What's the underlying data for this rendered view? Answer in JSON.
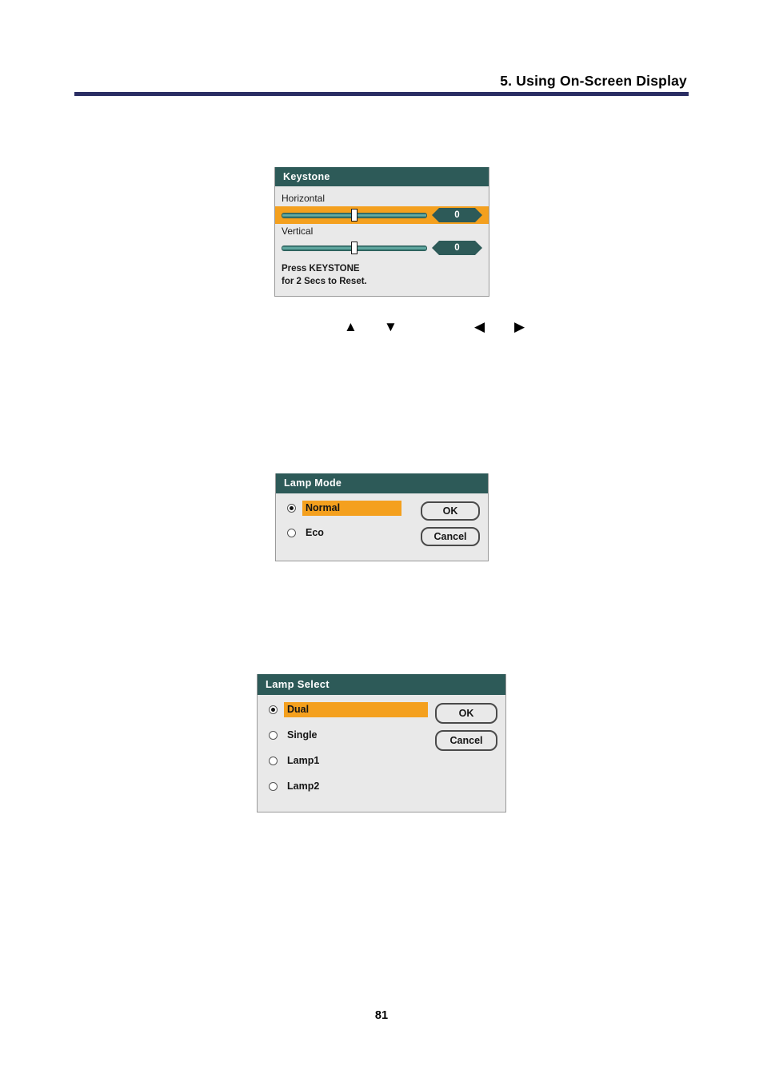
{
  "page": {
    "header_title": "5. Using On-Screen Display",
    "page_number": "81",
    "accent_navy": "#2a2d63",
    "osd_title_teal": "#2d5a58",
    "osd_body_gray": "#e9e9e9",
    "highlight_orange": "#f4a01e"
  },
  "keystone": {
    "title": "Keystone",
    "horizontal": {
      "label": "Horizontal",
      "value": "0",
      "slider_position_percent": 50
    },
    "vertical": {
      "label": "Vertical",
      "value": "0",
      "slider_position_percent": 50
    },
    "note_line1": "Press KEYSTONE",
    "note_line2": "for 2 Secs to Reset."
  },
  "arrows": {
    "up": "▲",
    "down": "▼",
    "left": "◀",
    "right": "▶"
  },
  "lamp_mode": {
    "title": "Lamp Mode",
    "options": [
      {
        "label": "Normal",
        "selected": true
      },
      {
        "label": "Eco",
        "selected": false
      }
    ],
    "buttons": [
      {
        "label": "OK"
      },
      {
        "label": "Cancel"
      }
    ]
  },
  "lamp_select": {
    "title": "Lamp Select",
    "options": [
      {
        "label": "Dual",
        "selected": true
      },
      {
        "label": "Single",
        "selected": false
      },
      {
        "label": "Lamp1",
        "selected": false
      },
      {
        "label": "Lamp2",
        "selected": false
      }
    ],
    "buttons": [
      {
        "label": "OK"
      },
      {
        "label": "Cancel"
      }
    ]
  }
}
